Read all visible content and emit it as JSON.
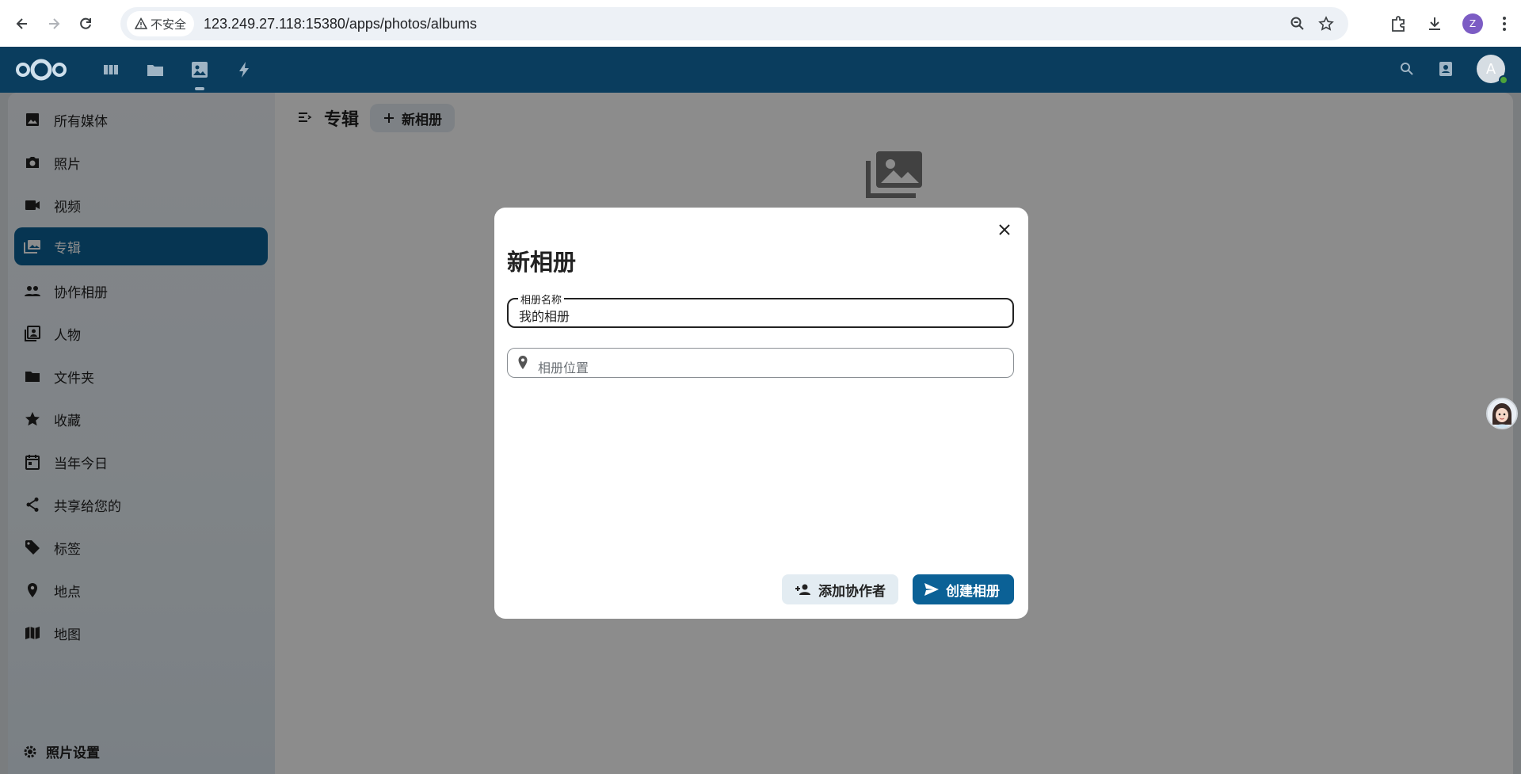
{
  "browser": {
    "security_label": "不安全",
    "url": "123.249.27.118:15380/apps/photos/albums",
    "profile_initial": "Z"
  },
  "header": {
    "avatar_initial": "A"
  },
  "sidebar": {
    "items": [
      {
        "label": "所有媒体",
        "icon": "image-icon"
      },
      {
        "label": "照片",
        "icon": "camera-icon"
      },
      {
        "label": "视频",
        "icon": "video-icon"
      },
      {
        "label": "专辑",
        "icon": "album-icon",
        "active": true
      },
      {
        "label": "协作相册",
        "icon": "group-icon"
      },
      {
        "label": "人物",
        "icon": "people-icon"
      },
      {
        "label": "文件夹",
        "icon": "folder-icon"
      },
      {
        "label": "收藏",
        "icon": "star-icon"
      },
      {
        "label": "当年今日",
        "icon": "calendar-icon"
      },
      {
        "label": "共享给您的",
        "icon": "share-icon"
      },
      {
        "label": "标签",
        "icon": "tag-icon"
      },
      {
        "label": "地点",
        "icon": "pin-icon"
      },
      {
        "label": "地图",
        "icon": "map-icon"
      }
    ],
    "footer_label": "照片设置"
  },
  "main": {
    "title": "专辑",
    "new_album_label": "新相册"
  },
  "modal": {
    "title": "新相册",
    "name_label": "相册名称",
    "name_value": "我的相册",
    "location_placeholder": "相册位置",
    "add_collaborators_label": "添加协作者",
    "create_label": "创建相册"
  },
  "colors": {
    "primary": "#0b6196",
    "header": "#0a3d5e"
  }
}
